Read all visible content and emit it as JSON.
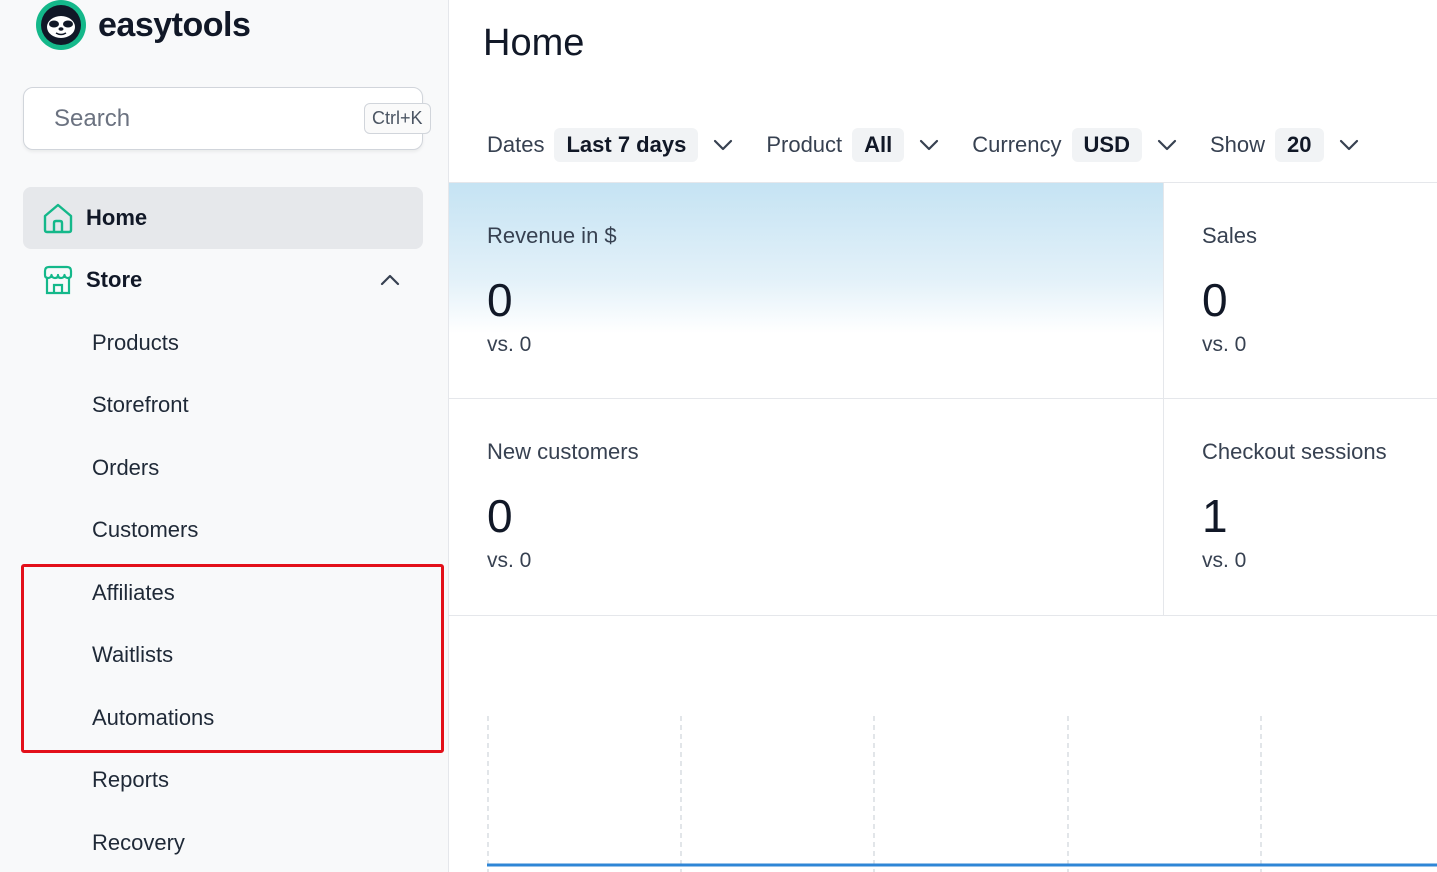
{
  "brand": {
    "name": "easytools"
  },
  "search": {
    "placeholder": "Search",
    "shortcut": "Ctrl+K"
  },
  "nav": {
    "home": {
      "label": "Home"
    },
    "store": {
      "label": "Store",
      "items": [
        "Products",
        "Storefront",
        "Orders",
        "Customers",
        "Affiliates",
        "Waitlists",
        "Automations",
        "Reports",
        "Recovery"
      ]
    }
  },
  "main": {
    "title": "Home",
    "filters": [
      {
        "label": "Dates",
        "value": "Last 7 days"
      },
      {
        "label": "Product",
        "value": "All"
      },
      {
        "label": "Currency",
        "value": "USD"
      },
      {
        "label": "Show",
        "value": "20"
      }
    ],
    "stats": [
      {
        "label": "Revenue in $",
        "value": "0",
        "compare": "vs. 0"
      },
      {
        "label": "Sales",
        "value": "0",
        "compare": "vs. 0"
      },
      {
        "label": "New customers",
        "value": "0",
        "compare": "vs. 0"
      },
      {
        "label": "Checkout sessions",
        "value": "1",
        "compare": "vs. 0"
      }
    ]
  },
  "colors": {
    "accent": "#14b88a",
    "highlight": "#e3101a",
    "chart_line": "#2f86d6"
  }
}
